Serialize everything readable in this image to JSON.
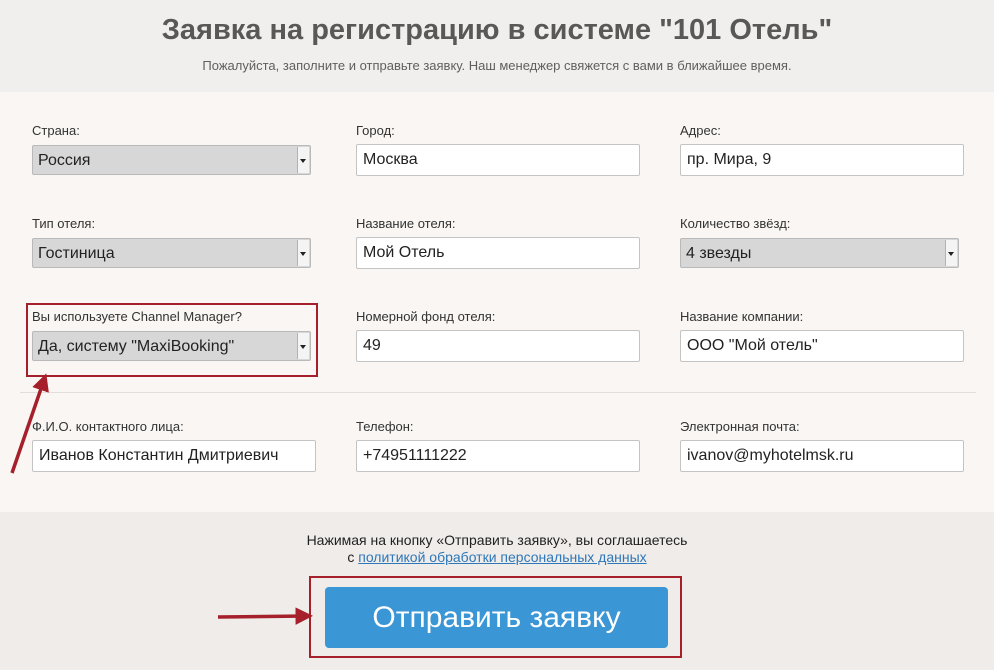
{
  "header": {
    "title": "Заявка на регистрацию в системе \"101 Отель\"",
    "subtitle": "Пожалуйста, заполните и отправьте заявку. Наш менеджер свяжется с вами в ближайшее время."
  },
  "form": {
    "country": {
      "label": "Страна:",
      "value": "Россия"
    },
    "city": {
      "label": "Город:",
      "value": "Москва"
    },
    "address": {
      "label": "Адрес:",
      "value": "пр. Мира, 9"
    },
    "hotel_type": {
      "label": "Тип отеля:",
      "value": "Гостиница"
    },
    "hotel_name": {
      "label": "Название отеля:",
      "value": "Мой Отель"
    },
    "stars": {
      "label": "Количество звёзд:",
      "value": "4 звезды"
    },
    "channel_manager": {
      "label": "Вы используете Channel Manager?",
      "value": "Да, систему \"MaxiBooking\""
    },
    "room_count": {
      "label": "Номерной фонд отеля:",
      "value": "49"
    },
    "company_name": {
      "label": "Название компании:",
      "value": "ООО \"Мой отель\""
    },
    "contact_name": {
      "label": "Ф.И.О. контактного лица:",
      "value": "Иванов Константин Дмитриевич"
    },
    "phone": {
      "label": "Телефон:",
      "value": "+74951111222"
    },
    "email": {
      "label": "Электронная почта:",
      "value": "ivanov@myhotelmsk.ru"
    }
  },
  "footer": {
    "agree_text": "Нажимая на кнопку «Отправить заявку», вы соглашаетесь",
    "agree_prefix": "с",
    "privacy_link": "политикой обработки персональных данных",
    "submit_label": "Отправить заявку"
  },
  "colors": {
    "submit": "#3b96d5",
    "highlight": "#a5202b",
    "link": "#2e77b8"
  }
}
